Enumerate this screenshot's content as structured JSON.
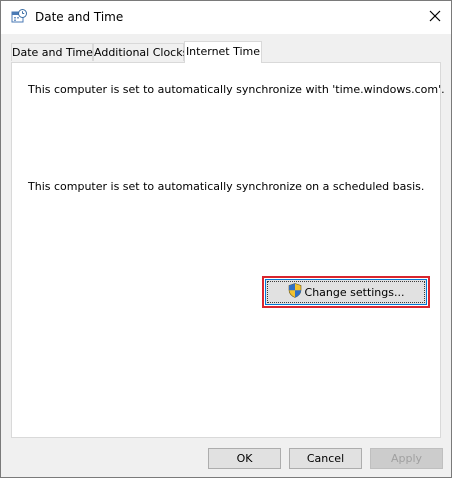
{
  "window": {
    "title": "Date and Time"
  },
  "tabs": [
    {
      "label": "Date and Time",
      "active": false
    },
    {
      "label": "Additional Clocks",
      "active": false
    },
    {
      "label": "Internet Time",
      "active": true
    }
  ],
  "panel": {
    "sync_server_text": "This computer is set to automatically synchronize with 'time.windows.com'.",
    "sync_schedule_text": "This computer is set to automatically synchronize on a scheduled basis.",
    "change_settings_label": "Change settings..."
  },
  "footer": {
    "ok_label": "OK",
    "cancel_label": "Cancel",
    "apply_label": "Apply"
  },
  "icons": {
    "title": "clock-calendar-icon",
    "close": "close-icon",
    "admin": "uac-shield-icon"
  },
  "colors": {
    "highlight_border": "#d9252e",
    "focus_border": "#0078d7",
    "disabled_text": "#a0a0a0"
  }
}
